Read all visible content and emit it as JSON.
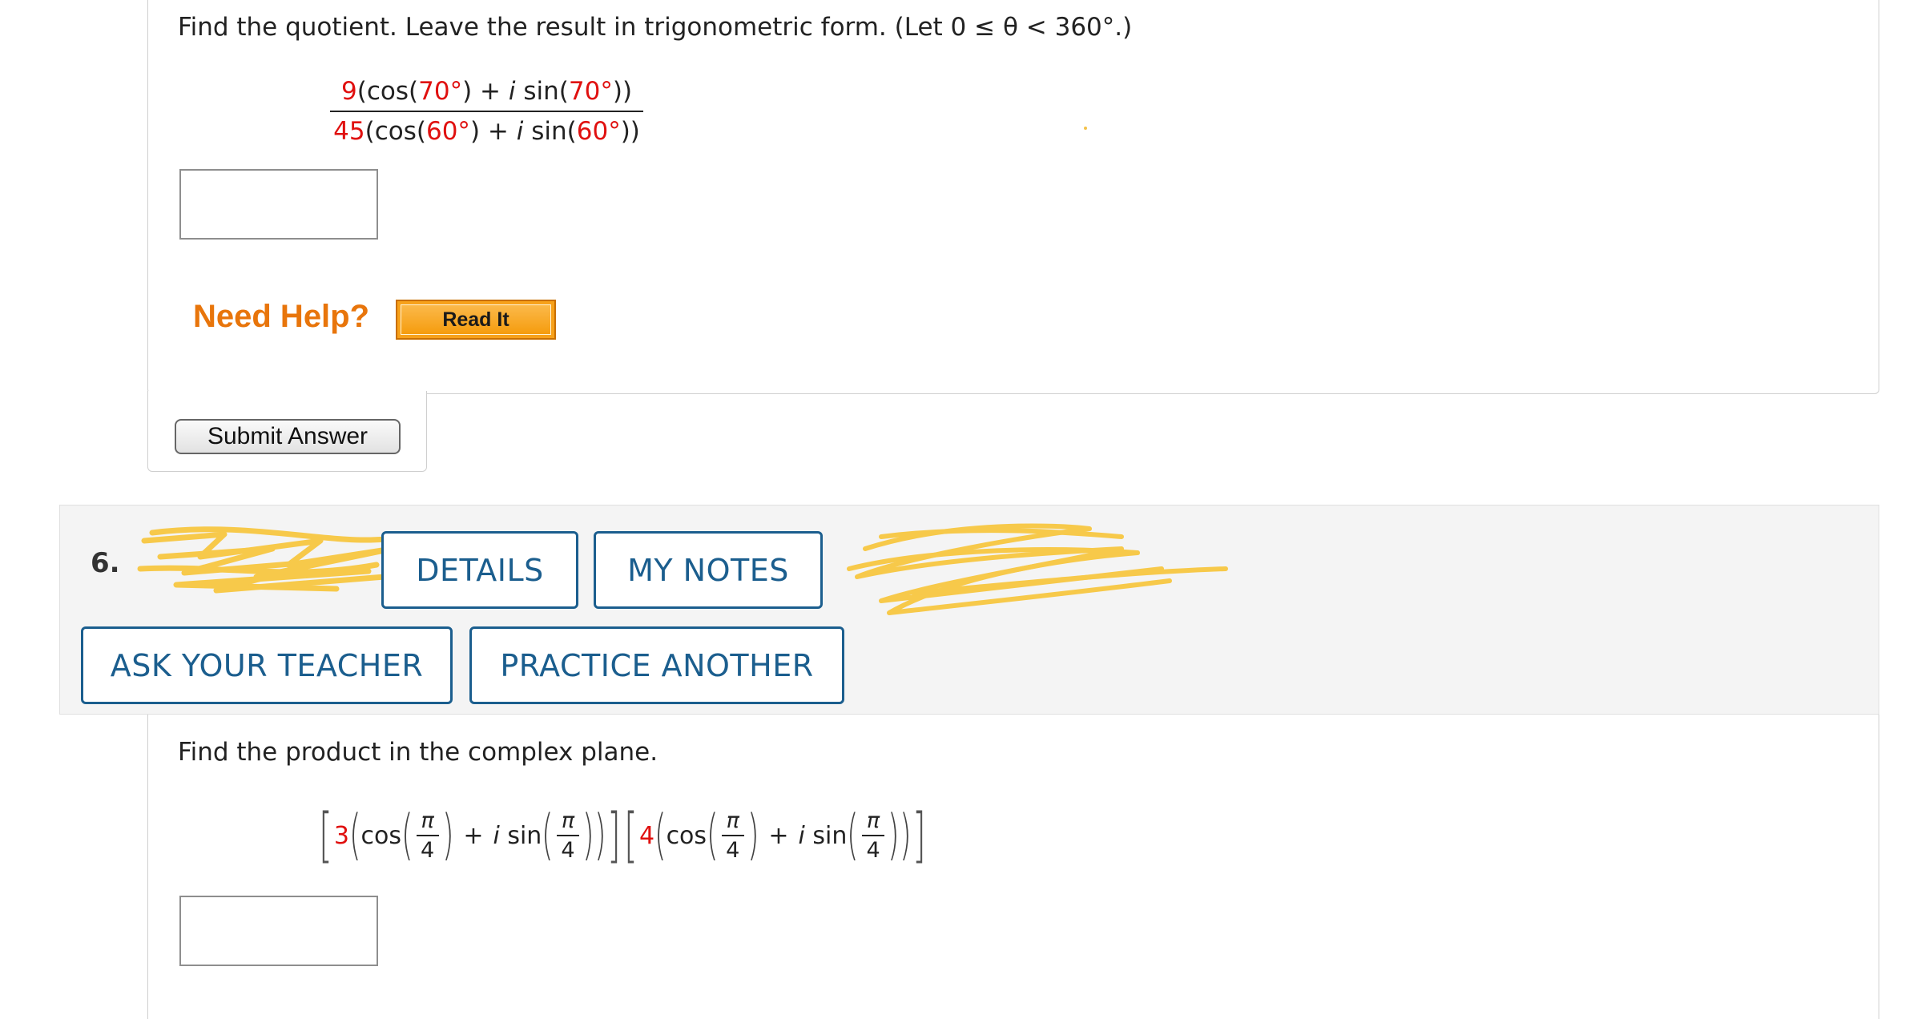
{
  "question5": {
    "prompt": "Find the quotient. Leave the result in trigonometric form. (Let 0 ≤ θ < 360°.)",
    "numerator": {
      "coef": "9",
      "angle1": "70°",
      "angle2": "70°"
    },
    "denominator": {
      "coef": "45",
      "angle1": "60°",
      "angle2": "60°"
    },
    "fn_cos": "cos",
    "fn_sin": "sin",
    "imag": "i",
    "plus": "+",
    "answer_value": "",
    "need_help_label": "Need Help?",
    "read_it_label": "Read It",
    "submit_label": "Submit Answer"
  },
  "question6": {
    "number": "6.",
    "buttons": {
      "details": "DETAILS",
      "my_notes": "MY NOTES",
      "ask_teacher": "ASK YOUR TEACHER",
      "practice_another": "PRACTICE ANOTHER"
    },
    "prompt": "Find the product in the complex plane.",
    "factor1": {
      "coef": "3",
      "num": "π",
      "den": "4"
    },
    "factor2": {
      "coef": "4",
      "num": "π",
      "den": "4"
    },
    "fn_cos": "cos",
    "fn_sin": "sin",
    "imag": "i",
    "plus": "+",
    "answer_value": ""
  },
  "colors": {
    "accent_blue": "#1b5e8e",
    "highlight_red": "#e0100f",
    "help_orange": "#e8750b",
    "redaction_yellow": "#f7c94a"
  }
}
